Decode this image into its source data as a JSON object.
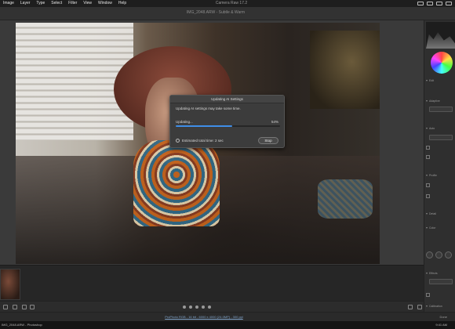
{
  "menubar": {
    "items": [
      "Image",
      "Layer",
      "Type",
      "Select",
      "Filter",
      "View",
      "Window",
      "Help"
    ],
    "app_title": "Camera Raw 17.2"
  },
  "document": {
    "tab_label": "IMG_2048.ARW  -  Subtle & Warm"
  },
  "dialog": {
    "title": "Updating AI Settings",
    "message": "Updating AI settings may take some time.",
    "progress_label": "Updating...",
    "progress_text": "54%",
    "progress_value": 0.54,
    "estimate": "Estimated total time: 2 sec",
    "stop_label": "Stop",
    "accent_color": "#3f8ee8"
  },
  "right_panel": {
    "sections": [
      "Edit",
      "Profile",
      "Masking",
      "Presets",
      "Curve",
      "Detail",
      "Color Mixer",
      "Effects",
      "Calibration"
    ],
    "row_labels": [
      "Edit",
      "Adaptive",
      "Auto",
      "Profile",
      "Detail",
      "Color",
      "Effects",
      "Optics",
      "Geometry",
      "Calibration"
    ]
  },
  "status": {
    "link": "ProPhoto RGB - 16 bit - 6000 x 4000 (24.0MP) - 300 ppi",
    "right": "Done"
  },
  "taskbar": {
    "left": "IMG_2048.ARW - Photoshop",
    "right_time": "9:41 AM"
  }
}
